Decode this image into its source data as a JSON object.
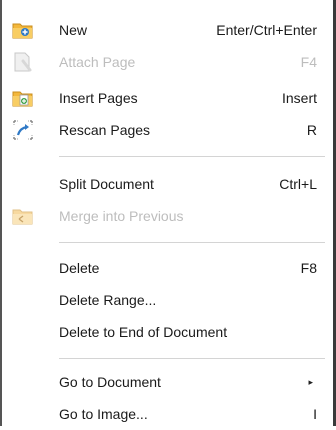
{
  "menu": {
    "items": [
      {
        "label": "New",
        "shortcut": "Enter/Ctrl+Enter",
        "icon": "new-folder-icon"
      },
      {
        "label": "Attach Page",
        "shortcut": "F4",
        "icon": "attach-page-icon",
        "disabled": true
      },
      {
        "label": "Insert Pages",
        "shortcut": "Insert",
        "icon": "insert-pages-icon"
      },
      {
        "label": "Rescan Pages",
        "shortcut": "R",
        "icon": "rescan-icon"
      },
      {
        "label": "Split Document",
        "shortcut": "Ctrl+L"
      },
      {
        "label": "Merge into Previous",
        "icon": "merge-folder-icon",
        "disabled": true
      },
      {
        "label": "Delete",
        "shortcut": "F8"
      },
      {
        "label": "Delete Range..."
      },
      {
        "label": "Delete to End of Document"
      },
      {
        "label": "Go to Document",
        "submenu_arrow": "▸"
      },
      {
        "label": "Go to Image...",
        "shortcut": "I"
      }
    ]
  },
  "colors": {
    "folder": "#f3b73b",
    "accent_blue": "#2f79c6",
    "disabled_text": "#bdbdbd",
    "separator": "#d4d4d4"
  }
}
